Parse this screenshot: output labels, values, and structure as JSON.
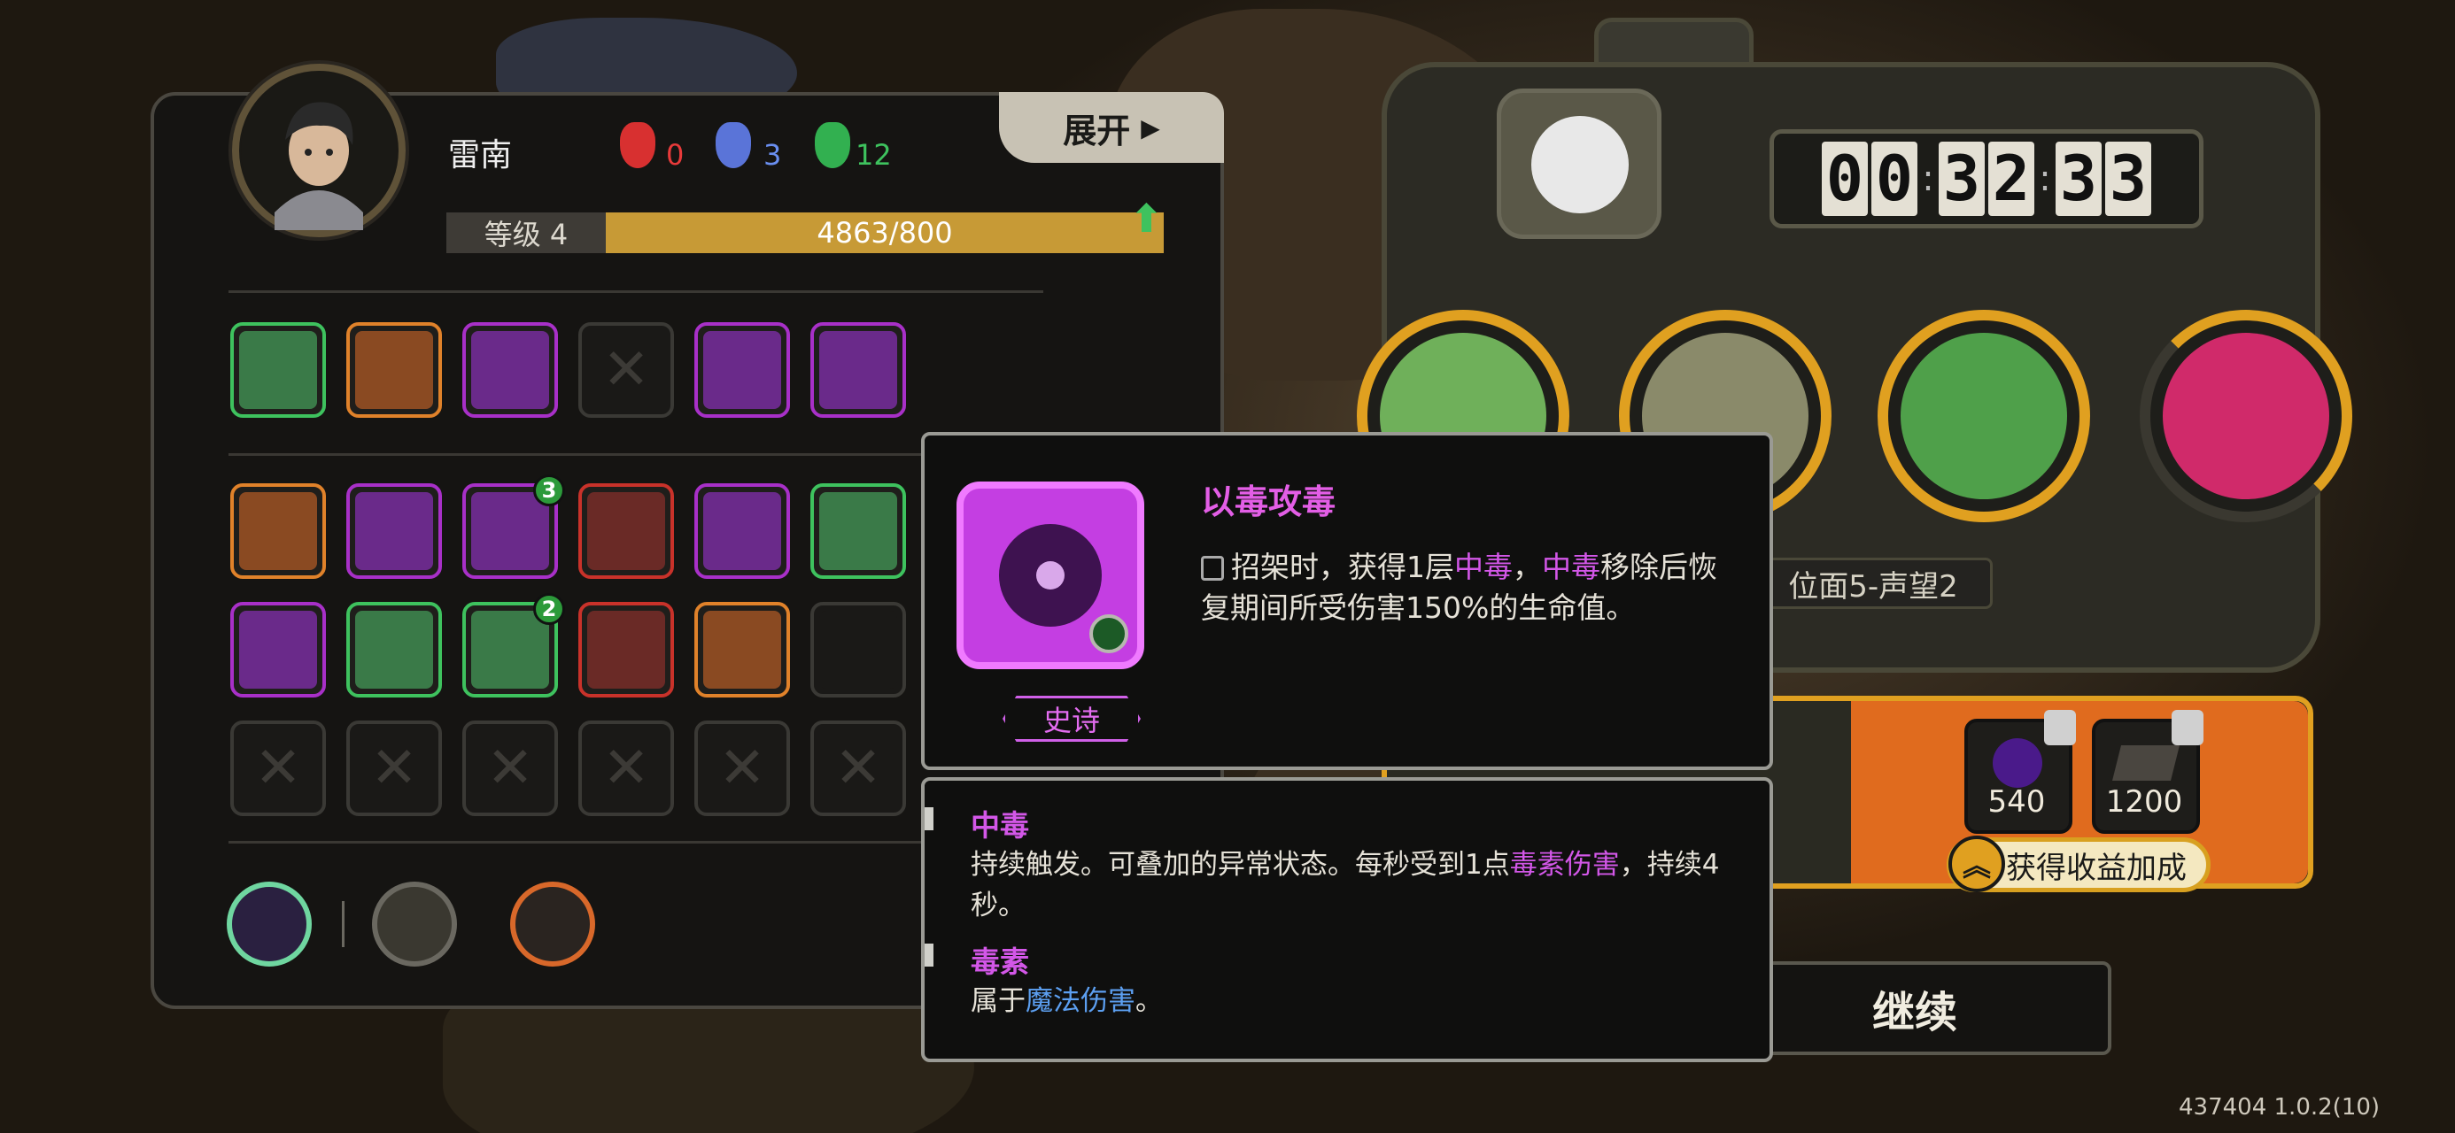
{
  "hero": {
    "name": "雷南",
    "level_label": "等级 4",
    "xp_text": "4863/800",
    "xp_fraction": 1.0,
    "resources": [
      {
        "icon": "red-demon-mask-icon",
        "value": "0",
        "color": "#e83a3a"
      },
      {
        "icon": "blue-demon-mask-icon",
        "value": "3",
        "color": "#6a8ff0"
      },
      {
        "icon": "green-demon-mask-icon",
        "value": "12",
        "color": "#3ec25e"
      }
    ]
  },
  "expand_button": "展开",
  "equipment_slots": [
    {
      "icon": "sword-slash-icon",
      "rarity": "green"
    },
    {
      "icon": "fire-demon-icon",
      "rarity": "orange"
    },
    {
      "icon": "purple-eye-orb-icon",
      "rarity": "purple"
    },
    {
      "icon": "empty-slot-icon",
      "rarity": "empty"
    },
    {
      "icon": "purple-armor-icon",
      "rarity": "purple"
    },
    {
      "icon": "poison-eye-icon",
      "rarity": "purple"
    }
  ],
  "skill_rows": [
    [
      {
        "icon": "green-shield-tooth-icon",
        "rarity": "orange",
        "badge": ""
      },
      {
        "icon": "purple-crown-icon",
        "rarity": "purple",
        "badge": ""
      },
      {
        "icon": "flesh-spine-icon",
        "rarity": "purple",
        "badge": "3"
      },
      {
        "icon": "teal-claw-icon",
        "rarity": "red",
        "badge": ""
      },
      {
        "icon": "purple-spike-orb-icon",
        "rarity": "purple",
        "badge": ""
      },
      {
        "icon": "red-slash-icon",
        "rarity": "green",
        "badge": ""
      }
    ],
    [
      {
        "icon": "lightning-bullet-icon",
        "rarity": "purple",
        "badge": ""
      },
      {
        "icon": "purple-ghost-hands-icon",
        "rarity": "green",
        "badge": ""
      },
      {
        "icon": "poison-drip-icon",
        "rarity": "green",
        "badge": "2"
      },
      {
        "icon": "red-infinity-icon",
        "rarity": "red",
        "badge": ""
      },
      {
        "icon": "purple-skull-icon",
        "rarity": "orange",
        "badge": ""
      },
      {
        "icon": "crimson-burst-icon",
        "rarity": "empty",
        "badge": ""
      }
    ],
    [
      {
        "icon": "empty-slot-icon",
        "rarity": "empty",
        "badge": ""
      },
      {
        "icon": "empty-slot-icon",
        "rarity": "empty",
        "badge": ""
      },
      {
        "icon": "empty-slot-icon",
        "rarity": "empty",
        "badge": ""
      },
      {
        "icon": "empty-slot-icon",
        "rarity": "empty",
        "badge": ""
      },
      {
        "icon": "empty-slot-icon",
        "rarity": "empty",
        "badge": ""
      },
      {
        "icon": "empty-slot-icon",
        "rarity": "empty",
        "badge": ""
      }
    ]
  ],
  "bottom_icons": [
    "swirl-emblem-icon",
    "rune-stone-icon",
    "crossed-daggers-icon"
  ],
  "timer": {
    "digits": [
      "0",
      "0",
      "3",
      "2",
      "3",
      "3"
    ]
  },
  "boss_icon": "duck-face-icon",
  "stages": [
    {
      "icon": "green-horn-beast-icon",
      "color": "#6fb05a"
    },
    {
      "icon": "serpent-mask-icon",
      "color": "#8a8a6a"
    },
    {
      "icon": "horned-demon-icon",
      "color": "#4fa04a"
    },
    {
      "icon": "crimson-dragon-icon",
      "color": "#d02a6a"
    }
  ],
  "region_text": "位面5-声望2",
  "rewards": [
    {
      "icon": "purple-orb-icon",
      "value": "540",
      "locked": true
    },
    {
      "icon": "dark-book-icon",
      "value": "1200",
      "locked": true
    }
  ],
  "bonus_button": "获得收益加成",
  "continue_button": "继续",
  "version": "437404 1.0.2(10)",
  "tooltip": {
    "title": "以毒攻毒",
    "desc_prefix": "招架时，获得1层",
    "kw1": "中毒",
    "desc_mid": "，",
    "kw2": "中毒",
    "desc_suffix": "移除后恢复期间所受伤害150%的生命值。",
    "rarity": "史诗",
    "icon": "poison-eye-icon"
  },
  "keywords": [
    {
      "title": "中毒",
      "body_prefix": "持续触发。可叠加的异常状态。每秒受到1点",
      "body_kw": "毒素伤害",
      "body_suffix": "，持续4秒。"
    },
    {
      "title": "毒素",
      "body_prefix": "属于",
      "body_kw": "魔法伤害",
      "body_suffix": "。"
    }
  ]
}
